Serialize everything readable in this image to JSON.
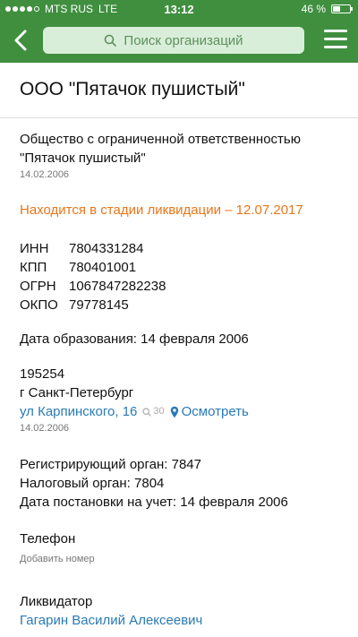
{
  "status_bar": {
    "carrier": "MTS RUS",
    "network": "LTE",
    "time": "13:12",
    "battery": "46 %",
    "battery_level": 0.46
  },
  "nav": {
    "search_placeholder": "Поиск организаций"
  },
  "org": {
    "title": "ООО \"Пятачок пушистый\"",
    "full_name_line1": "Общество с ограниченной ответственностью",
    "full_name_line2": "\"Пятачок пушистый\"",
    "name_date": "14.02.2006",
    "status": "Находится в стадии ликвидации – 12.07.2017",
    "codes": [
      {
        "label": "ИНН",
        "value": "7804331284"
      },
      {
        "label": "КПП",
        "value": "780401001"
      },
      {
        "label": "ОГРН",
        "value": "1067847282238"
      },
      {
        "label": "ОКПО",
        "value": "79778145"
      }
    ],
    "registration_date": "Дата образования: 14 февраля 2006",
    "address": {
      "zip": "195254",
      "city": "г Санкт-Петербург",
      "street": "ул Карпинского, 16",
      "views": "30",
      "view_link": "Осмотреть",
      "date": "14.02.2006"
    },
    "registering_authority": "Регистрирующий орган: 7847",
    "tax_authority": "Налоговый орган: 7804",
    "tax_registration_date": "Дата постановки на учет: 14 февраля 2006",
    "phone_label": "Телефон",
    "add_phone": "Добавить номер",
    "liquidator_label": "Ликвидатор",
    "liquidator_name": "Гагарин Василий Алексеевич"
  },
  "colors": {
    "header_green": "#3f8f3f",
    "status_orange": "#e8761a",
    "link_blue": "#2a7ab5"
  }
}
